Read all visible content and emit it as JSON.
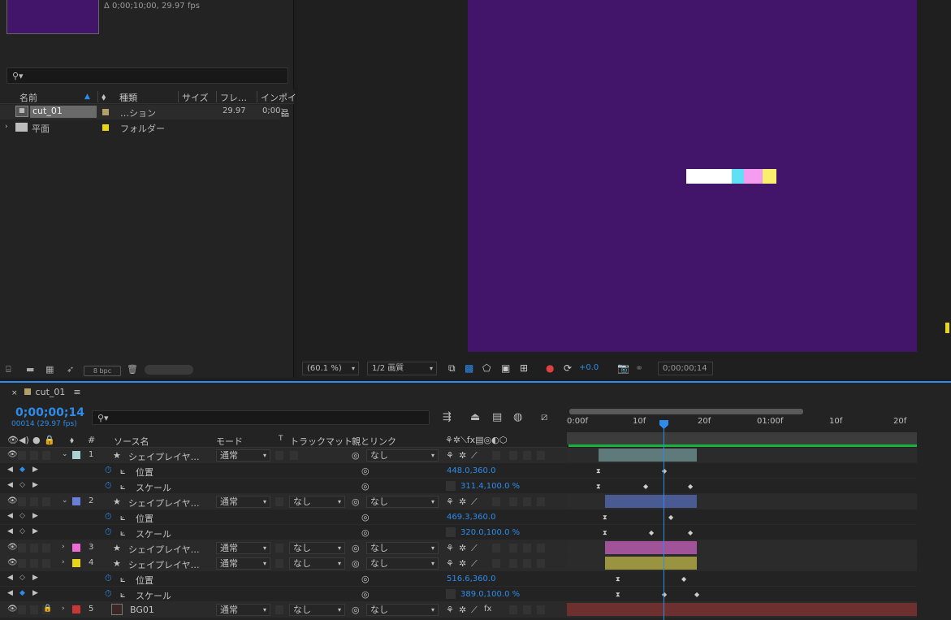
{
  "project": {
    "info": "Δ 0;00;10;00, 29.97 fps",
    "search_icon": "search-icon",
    "columns": [
      "名前",
      "種類",
      "サイズ",
      "フレ…",
      "インポイ"
    ],
    "items": [
      {
        "name": "cut_01",
        "type": "…ション",
        "fps": "29.97",
        "in": "0;00;",
        "label_color": "#b49f6a"
      },
      {
        "name": "平面",
        "type": "フォルダー",
        "fps": "",
        "in": "",
        "label_color": "#e9d41c"
      }
    ],
    "bpc": "8 bpc"
  },
  "viewer": {
    "zoom": "(60.1 %)",
    "quality": "1/2 画質",
    "exposure": "+0.0",
    "timecode": "0;00;00;14",
    "bars": [
      "#ffffff",
      "#5fe0f5",
      "#f59cf0",
      "#faf06e"
    ]
  },
  "timeline": {
    "tab_label": "cut_01",
    "timecode": "0;00;00;14",
    "timecode_sub": "00014 (29.97 fps)",
    "columns": {
      "source": "ソース名",
      "mode": "モード",
      "t": "T",
      "trackmatte": "トラックマット",
      "parent": "親とリンク",
      "hash": "#"
    },
    "ruler": [
      "0:00f",
      "10f",
      "20f",
      "01:00f",
      "10f",
      "20f"
    ],
    "rows": [
      {
        "kind": "layer",
        "num": "1",
        "name": "シェイプレイヤ…",
        "mode": "通常",
        "matte": "",
        "parent": "なし",
        "color": "#a9d1d1"
      },
      {
        "kind": "prop",
        "name": "位置",
        "value": "448.0,360.0"
      },
      {
        "kind": "prop",
        "name": "スケール",
        "value": "311.4,100.0 %"
      },
      {
        "kind": "layer",
        "num": "2",
        "name": "シェイプレイヤ…",
        "mode": "通常",
        "matte": "なし",
        "parent": "なし",
        "color": "#6a7fd8"
      },
      {
        "kind": "prop",
        "name": "位置",
        "value": "469.3,360.0"
      },
      {
        "kind": "prop",
        "name": "スケール",
        "value": "320.0,100.0 %"
      },
      {
        "kind": "layer",
        "num": "3",
        "name": "シェイプレイヤ…",
        "mode": "通常",
        "matte": "なし",
        "parent": "なし",
        "color": "#f06ad6"
      },
      {
        "kind": "layer",
        "num": "4",
        "name": "シェイプレイヤ…",
        "mode": "通常",
        "matte": "なし",
        "parent": "なし",
        "color": "#e9d41c"
      },
      {
        "kind": "prop",
        "name": "位置",
        "value": "516.6,360.0"
      },
      {
        "kind": "prop",
        "name": "スケール",
        "value": "389.0,100.0 %"
      },
      {
        "kind": "layer",
        "num": "5",
        "name": "BG01",
        "mode": "通常",
        "matte": "なし",
        "parent": "なし",
        "color": "#c93636"
      }
    ]
  }
}
